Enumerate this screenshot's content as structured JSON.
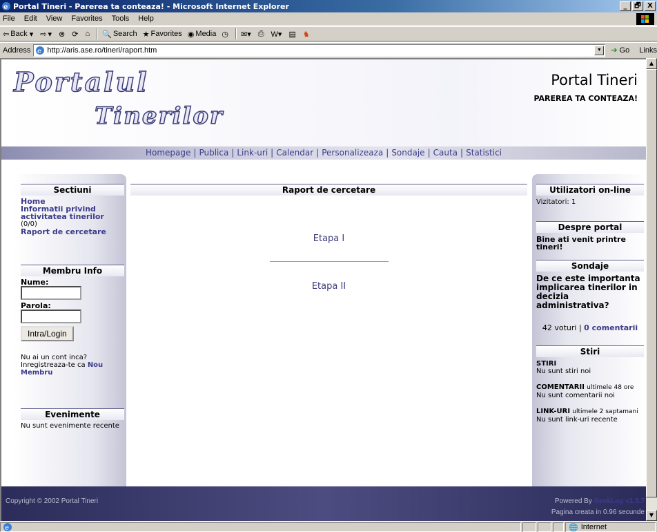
{
  "window": {
    "title": "Portal Tineri - Parerea ta conteaza! - Microsoft Internet Explorer",
    "buttons": [
      "_",
      "🗗",
      "X"
    ]
  },
  "menu": [
    "File",
    "Edit",
    "View",
    "Favorites",
    "Tools",
    "Help"
  ],
  "toolbar": {
    "back": "Back",
    "search": "Search",
    "favorites": "Favorites",
    "media": "Media"
  },
  "address": {
    "label": "Address",
    "url": "http://aris.ase.ro/tineri/raport.htm",
    "go": "Go",
    "links": "Links"
  },
  "header": {
    "logo_line1": "Portalul",
    "logo_line2": "Tinerilor",
    "site_title": "Portal Tineri",
    "slogan": "PAREREA TA CONTEAZA!"
  },
  "nav": [
    "Homepage",
    "Publica",
    "Link-uri",
    "Calendar",
    "Personalizeaza",
    "Sondaje",
    "Cauta",
    "Statistici"
  ],
  "left": {
    "sections_title": "Sectiuni",
    "sections": {
      "home": "Home",
      "info": "Informatii privind activitatea tinerilor",
      "info_count": "(0/0)",
      "raport": "Raport de cercetare"
    },
    "member_title": "Membru Info",
    "name_label": "Nume:",
    "password_label": "Parola:",
    "login_button": "Intra/Login",
    "no_account": "Nu ai un cont inca? Inregistreaza-te ca ",
    "new_member": "Nou Membru",
    "events_title": "Evenimente",
    "events_text": "Nu sunt evenimente recente"
  },
  "center": {
    "title": "Raport de cercetare",
    "stage1": "Etapa I",
    "stage2": "Etapa II"
  },
  "right": {
    "online_title": "Utilizatori on-line",
    "visitors": "Vizitatori: 1",
    "about_title": "Despre portal",
    "about_text": "Bine ati venit printre tineri!",
    "poll_title": "Sondaje",
    "poll_question": "De ce este importanta implicarea tinerilor in decizia administrativa?",
    "poll_votes": "42 voturi",
    "poll_comments": "0 comentarii",
    "news_title": "Stiri",
    "stiri_label": "STIRI",
    "stiri_text": "Nu sunt stiri noi",
    "comments_label": "COMENTARII",
    "comments_period": "ultimele 48 ore",
    "comments_text": "Nu sunt comentarii noi",
    "links_label": "LINK-URI",
    "links_period": "ultimele 2 saptamani",
    "links_text": "Nu sunt link-uri recente"
  },
  "footer": {
    "copyright": "Copyright © 2002 Portal Tineri",
    "powered_prefix": "Powered By ",
    "powered_name": "GeekLog v1.3.7",
    "generated": "Pagina creata in 0.96 secunde"
  },
  "status": {
    "zone": "Internet"
  }
}
